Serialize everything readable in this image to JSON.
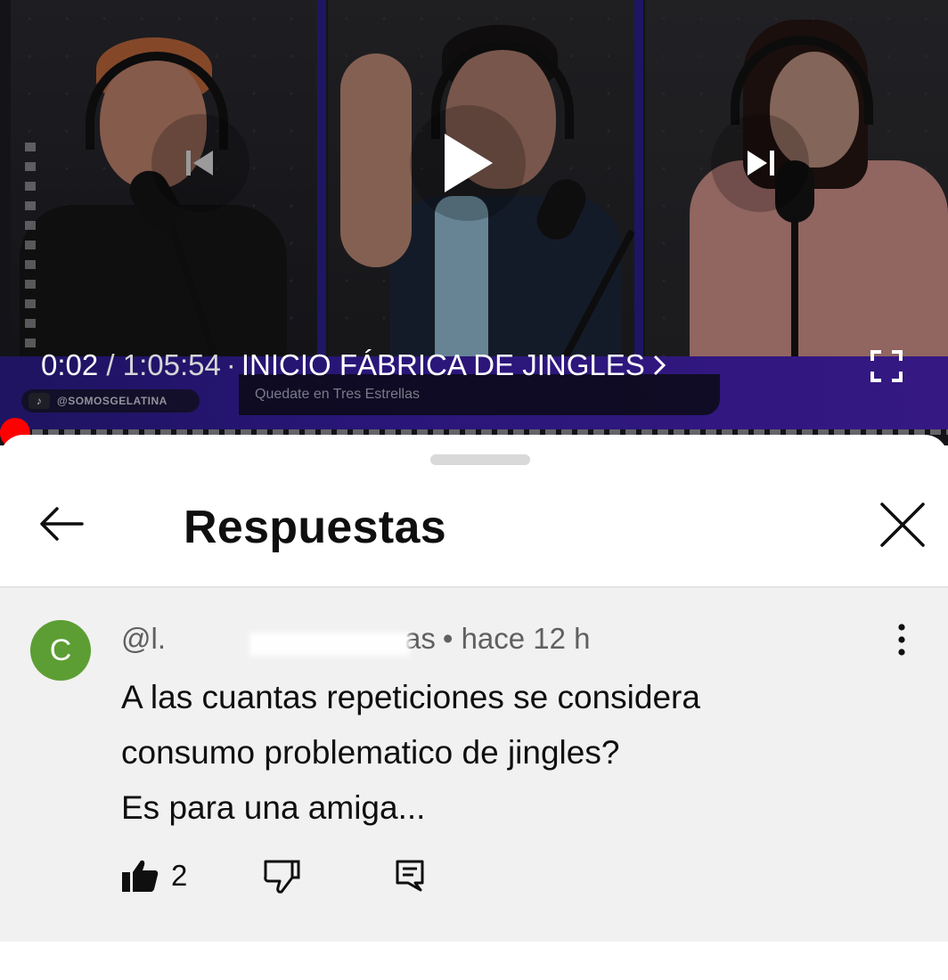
{
  "player": {
    "current_time": "0:02",
    "separator": " / ",
    "duration": "1:05:54",
    "chapter_bullet": "·",
    "chapter_title": "INICIO FÁBRICA DE JINGLES",
    "progress_fraction": 0.0005,
    "overlay_tag": "@SOMOSGELATINA",
    "overlay_tag_icon": "tiktok-icon",
    "overlay_subtitle": "Quedate en Tres Estrellas",
    "controls": {
      "prev": "skip-previous-icon",
      "play": "play-icon",
      "next": "skip-next-icon",
      "fullscreen": "fullscreen-icon"
    },
    "accent_color": "#ff0000"
  },
  "sheet": {
    "title": "Respuestas",
    "back_icon": "arrow-back-icon",
    "close_icon": "close-icon"
  },
  "comment": {
    "avatar_letter": "C",
    "avatar_color": "#5c9e33",
    "author_prefix": "@l.",
    "author_suffix": "as",
    "time": "• hace 12 h",
    "lines": [
      "A las cuantas repeticiones se considera",
      "consumo problematico de jingles?",
      "Es para una amiga..."
    ],
    "likes": "2",
    "like_icon": "thumbs-up-filled-icon",
    "dislike_icon": "thumbs-down-icon",
    "reply_icon": "reply-comment-icon",
    "menu_icon": "more-vertical-icon"
  }
}
